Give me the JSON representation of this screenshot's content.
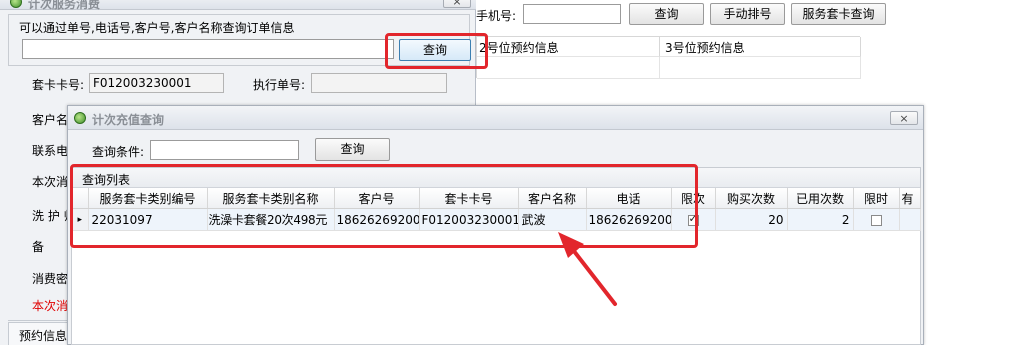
{
  "background": {
    "phone_label": "手机号:",
    "phone_value": "",
    "search_button": "查询",
    "manual_queue_button": "手动排号",
    "service_card_query_button": "服务套卡查询",
    "slot2_header": "2号位预约信息",
    "slot3_header": "3号位预约信息"
  },
  "consume_window": {
    "title": "计次服务消费",
    "close": "×",
    "hint": "可以通过单号,电话号,客户号,客户名称查询订单信息",
    "search_value": "",
    "search_button": "查询",
    "card_no_label": "套卡卡号:",
    "card_no_value": "F012003230001",
    "exec_no_label": "执行单号:",
    "exec_no_value": "",
    "customer_label": "客户名",
    "contact_label": "联系电",
    "this_consume_label": "本次消",
    "wash_label": "洗 护 师",
    "remark_label": "备",
    "consume_pwd_label": "消费密",
    "this_consume_red": "本次消",
    "reservation_tab": "预约信息"
  },
  "recharge_window": {
    "title": "计次充值查询",
    "close": "×",
    "condition_label": "查询条件:",
    "condition_value": "",
    "search_button": "查询",
    "list_title": "查询列表",
    "columns": [
      "服务套卡类别编号",
      "服务套卡类别名称",
      "客户号",
      "套卡卡号",
      "客户名称",
      "电话",
      "限次",
      "购买次数",
      "已用次数",
      "限时",
      "有"
    ],
    "rows": [
      {
        "marker": "▸",
        "type_code": "22031097",
        "type_name": "洗澡卡套餐20次498元",
        "customer_no": "18626269200",
        "card_no": "F012003230001",
        "customer_name": "武波",
        "phone": "18626269200",
        "limit_count": true,
        "bought": "20",
        "used": "2",
        "time_limited": false,
        "extra": ""
      }
    ]
  },
  "colors": {
    "annotation_red": "#e2262c",
    "label_red": "#e00000"
  }
}
